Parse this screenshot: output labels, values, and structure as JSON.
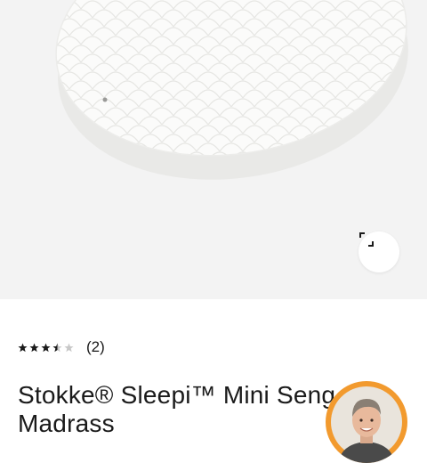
{
  "gallery": {
    "image_name": "mattress-image",
    "expand_icon": "expand-icon"
  },
  "product": {
    "rating": 3.5,
    "rating_max": 5,
    "review_count": "(2)",
    "title": "Stokke® Sleepi™ Mini Seng Madrass"
  },
  "advisor": {
    "icon": "advisor-avatar",
    "ring_color": "#f29a2e"
  },
  "colors": {
    "star_filled": "#1a1a1a",
    "star_empty": "#c8c8c8",
    "hero_background": "#f3f3f3"
  }
}
